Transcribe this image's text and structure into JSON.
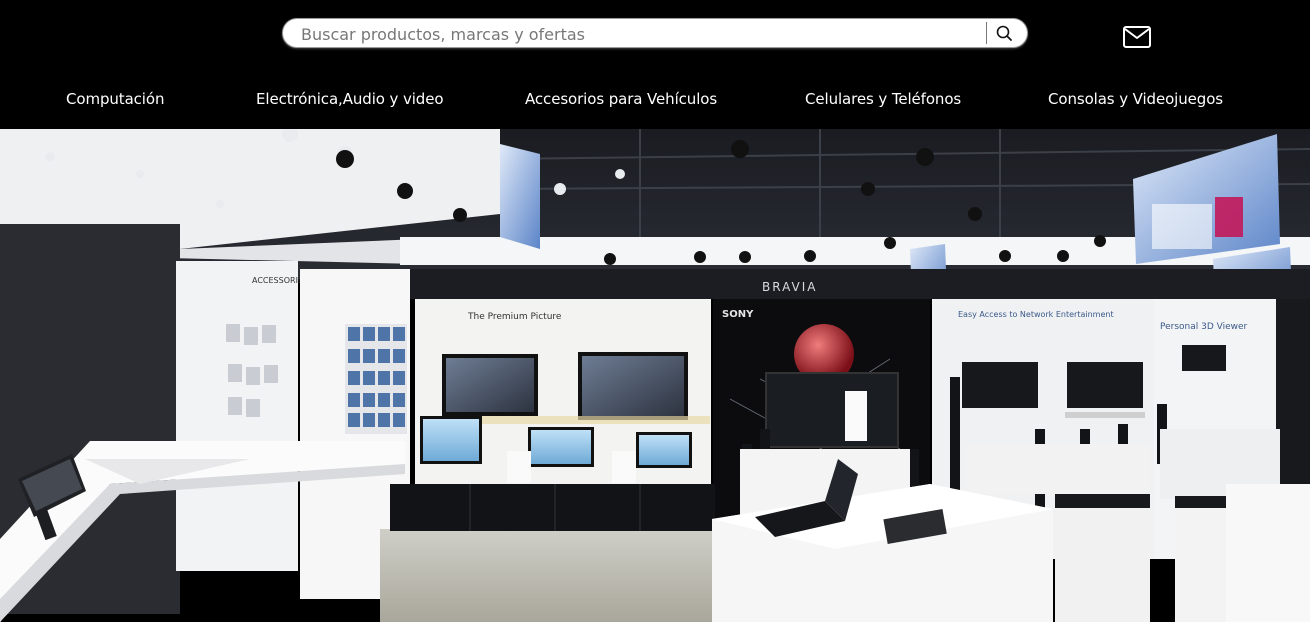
{
  "search": {
    "placeholder": "Buscar productos, marcas y ofertas",
    "value": ""
  },
  "icons": {
    "search": "search-icon",
    "mail": "mail-icon"
  },
  "nav": {
    "items": [
      {
        "label": "Computación"
      },
      {
        "label": "Electrónica,Audio y video"
      },
      {
        "label": "Accesorios para Vehículos"
      },
      {
        "label": "Celulares y Teléfonos"
      },
      {
        "label": "Consolas y Videojuegos"
      }
    ]
  },
  "hero": {
    "signs": {
      "bravia": "BRAVIA",
      "premium": "The Premium Picture",
      "network": "Easy Access to Network Entertainment",
      "viewer": "Personal 3D Viewer",
      "sony": "SONY",
      "accessories": "ACCESSORIES"
    }
  },
  "colors": {
    "header_bg": "#000000",
    "text": "#ffffff",
    "accent_line": "#6b4ad6"
  }
}
